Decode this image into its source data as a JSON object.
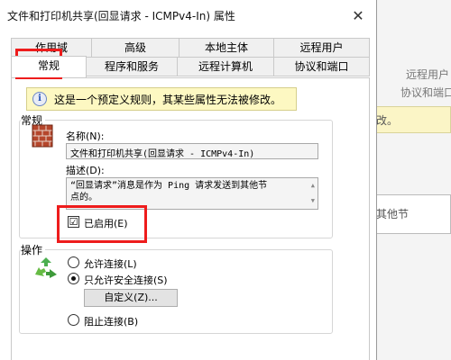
{
  "background": {
    "text_1": "远程用户",
    "text_2": "协议和端口",
    "text_3": "改。",
    "text_4": "其他节"
  },
  "dialog": {
    "title": "文件和打印机共享(回显请求 - ICMPv4-In) 属性",
    "close_glyph": "✕"
  },
  "tabs": {
    "row1": [
      "作用域",
      "高级",
      "本地主体",
      "远程用户"
    ],
    "row2": [
      "常规",
      "程序和服务",
      "远程计算机",
      "协议和端口"
    ],
    "active": "常规"
  },
  "info": {
    "icon": "i",
    "text": "这是一个预定义规则，其某些属性无法被修改。"
  },
  "general": {
    "group_label": "常规",
    "name_label": "名称(N):",
    "name_value": "文件和打印机共享(回显请求 - ICMPv4-In)",
    "desc_label": "描述(D):",
    "desc_line1": "“回显请求”消息是作为 Ping 请求发送到其他节",
    "desc_line2": "点的。",
    "enabled_label": "已启用(E)",
    "enabled_checked": "☑"
  },
  "action": {
    "group_label": "操作",
    "allow": "允许连接(L)",
    "allow_secure": "只允许安全连接(S)",
    "customize": "自定义(Z)...",
    "block": "阻止连接(B)"
  },
  "colors": {
    "highlight": "#ee1c1c",
    "info_bg": "#fdf8c2"
  }
}
